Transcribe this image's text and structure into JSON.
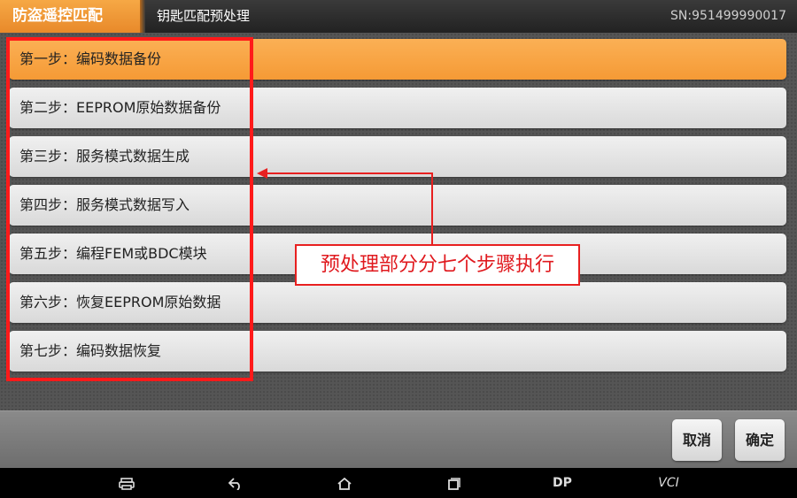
{
  "header": {
    "app_title": "防盗遥控匹配",
    "page_title": "钥匙匹配预处理",
    "serial": "SN:951499990017"
  },
  "steps": [
    {
      "label": "第一步：编码数据备份",
      "active": true
    },
    {
      "label": "第二步：EEPROM原始数据备份"
    },
    {
      "label": "第三步：服务模式数据生成"
    },
    {
      "label": "第四步：服务模式数据写入"
    },
    {
      "label": "第五步：编程FEM或BDC模块"
    },
    {
      "label": "第六步：恢复EEPROM原始数据"
    },
    {
      "label": "第七步：编码数据恢复"
    }
  ],
  "annotation": {
    "text": "预处理部分分七个步骤执行",
    "color": "#e0191e"
  },
  "buttons": {
    "cancel": "取消",
    "confirm": "确定"
  },
  "navbar": {
    "dp": "DP",
    "vci": "VCI"
  },
  "colors": {
    "accent": "#f59a35",
    "highlight": "#ff1a1a"
  }
}
